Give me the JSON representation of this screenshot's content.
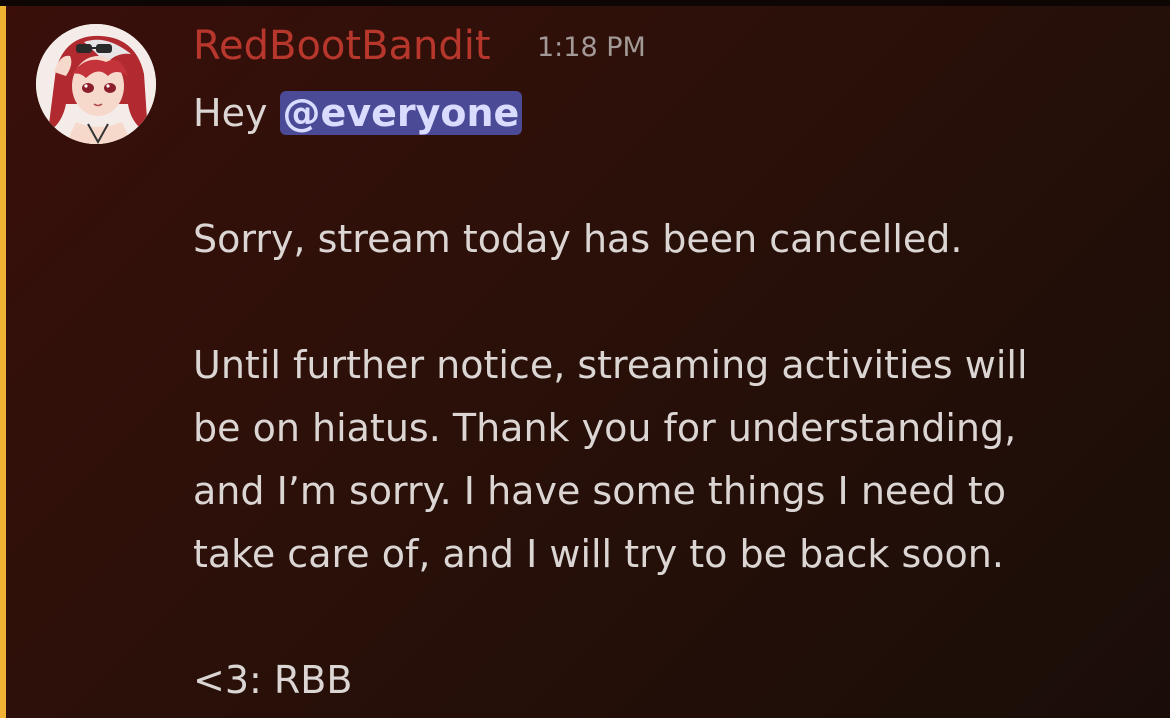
{
  "message": {
    "author": "RedBootBandit",
    "timestamp": "1:18 PM",
    "greeting": "Hey",
    "mention": "@everyone",
    "lines": [
      "Sorry, stream today has been cancelled.",
      "Until further notice, streaming activities will",
      "be on hiatus. Thank you for understanding,",
      "and I’m sorry. I have some things I need to",
      "take care of, and I will try to be back soon.",
      "<3: RBB"
    ]
  },
  "colors": {
    "username": "#b8372c",
    "highlight_bar": "#f0b232",
    "mention_bg": "#4a4a96",
    "text": "#dbd5d3"
  },
  "icons": {
    "avatar": "anime-character-avatar"
  }
}
